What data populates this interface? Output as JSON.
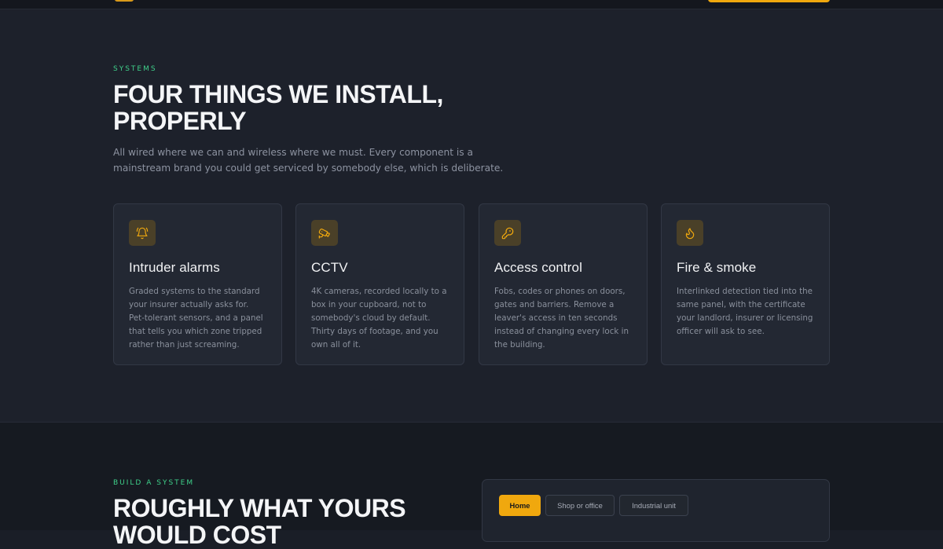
{
  "systems": {
    "eyebrow": "SYSTEMS",
    "heading": "FOUR THINGS WE INSTALL, PROPERLY",
    "lede": "All wired where we can and wireless where we must. Every component is a mainstream brand you could get serviced by somebody else, which is deliberate.",
    "cards": [
      {
        "icon": "bell-icon",
        "title": "Intruder alarms",
        "body": "Graded systems to the standard your insurer actually asks for. Pet-tolerant sensors, and a panel that tells you which zone tripped rather than just screaming."
      },
      {
        "icon": "cctv-camera-icon",
        "title": "CCTV",
        "body": "4K cameras, recorded locally to a box in your cupboard, not to somebody's cloud by default. Thirty days of footage, and you own all of it."
      },
      {
        "icon": "key-icon",
        "title": "Access control",
        "body": "Fobs, codes or phones on doors, gates and barriers. Remove a leaver's access in ten seconds instead of changing every lock in the building."
      },
      {
        "icon": "flame-icon",
        "title": "Fire & smoke",
        "body": "Interlinked detection tied into the same panel, with the certificate your landlord, insurer or licensing officer will ask to see."
      }
    ]
  },
  "build": {
    "eyebrow": "BUILD A SYSTEM",
    "heading": "ROUGHLY WHAT YOURS WOULD COST",
    "tabs": [
      {
        "label": "Home",
        "active": true
      },
      {
        "label": "Shop or office",
        "active": false
      },
      {
        "label": "Industrial unit",
        "active": false
      }
    ]
  },
  "colors": {
    "accent": "#f0a80e",
    "eyebrow": "#3fd08a",
    "icon_tint": "#f0a80e"
  }
}
